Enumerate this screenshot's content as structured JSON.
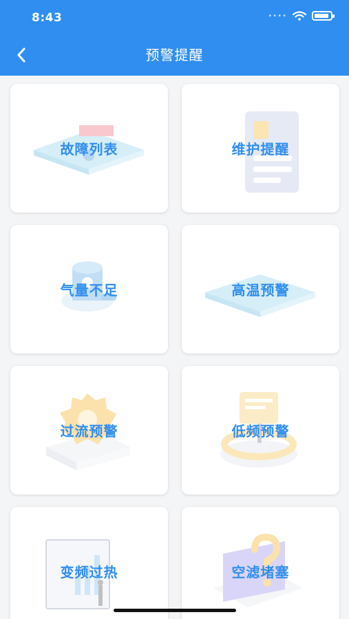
{
  "status_bar": {
    "time": "8:43"
  },
  "nav": {
    "title": "预警提醒"
  },
  "cards": [
    {
      "label": "故障列表",
      "icon": "fault-list-icon"
    },
    {
      "label": "维护提醒",
      "icon": "maintenance-reminder-icon"
    },
    {
      "label": "气量不足",
      "icon": "low-gas-icon"
    },
    {
      "label": "高温预警",
      "icon": "high-temperature-icon"
    },
    {
      "label": "过流预警",
      "icon": "overcurrent-icon"
    },
    {
      "label": "低频预警",
      "icon": "low-frequency-icon"
    },
    {
      "label": "变频过热",
      "icon": "inverter-overheat-icon"
    },
    {
      "label": "空滤堵塞",
      "icon": "air-filter-blocked-icon"
    }
  ],
  "colors": {
    "primary": "#2f8ef0",
    "background": "#f4f5f7",
    "card": "#ffffff"
  }
}
